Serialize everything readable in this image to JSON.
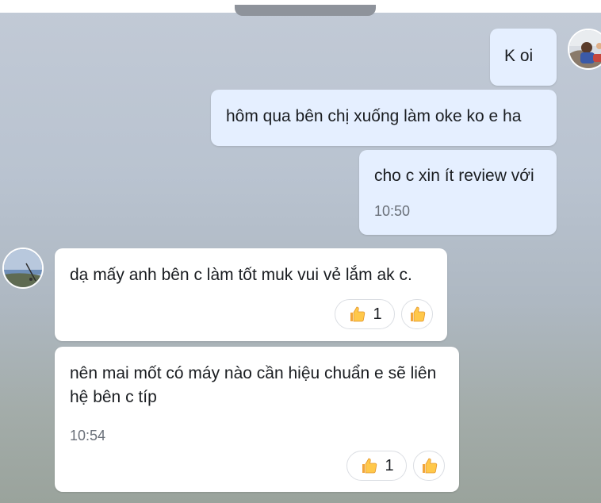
{
  "messages": [
    {
      "text": "K oi",
      "from": "me"
    },
    {
      "text": "hôm qua bên chị xuống làm oke ko e ha",
      "from": "me"
    },
    {
      "text": "cho c xin ít review với",
      "time": "10:50",
      "from": "me"
    },
    {
      "text": "dạ mấy anh bên c làm tốt muk vui vẻ lắm ak c.",
      "from": "other",
      "reaction": {
        "icon": "thumbs-up-icon",
        "count": "1"
      }
    },
    {
      "text": "nên mai mốt có máy nào cần hiệu chuẩn e sẽ liên hệ bên c típ",
      "time": "10:54",
      "from": "other",
      "reaction": {
        "icon": "thumbs-up-icon",
        "count": "1"
      }
    }
  ],
  "colors": {
    "outgoing_bubble": "#e5efff",
    "incoming_bubble": "#ffffff",
    "timestamp": "#6a7079"
  }
}
